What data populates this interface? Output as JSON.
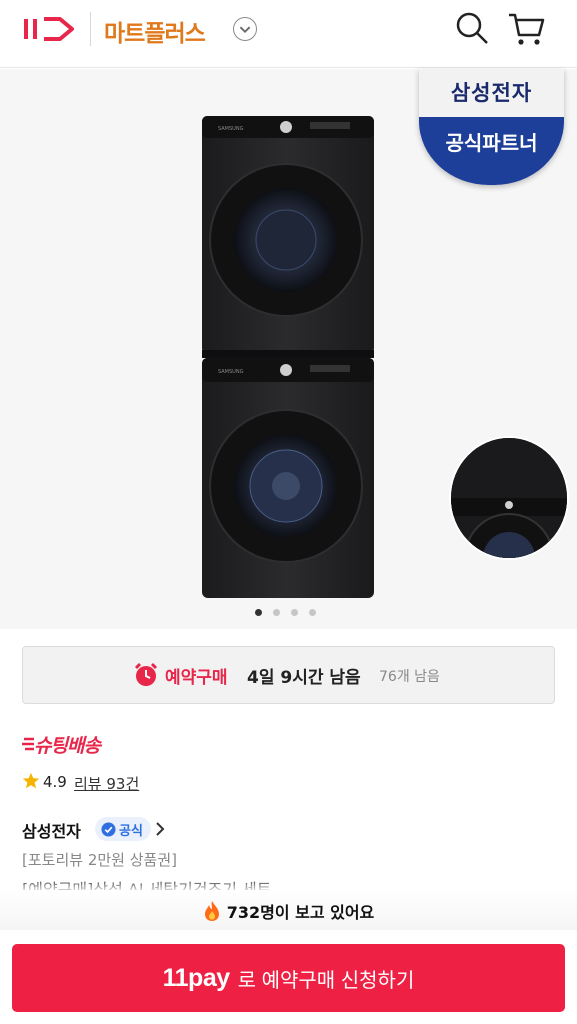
{
  "header": {
    "logo": "11",
    "brand": "마트플러스"
  },
  "gallery": {
    "badge_top": "삼성전자",
    "badge_bottom": "공식파트너",
    "pages": 4,
    "active_page": 1
  },
  "reservation": {
    "label": "예약구매",
    "time_left": "4일 9시간 남음",
    "remaining": "76개 남음"
  },
  "shipping": {
    "label": "슈팅배송"
  },
  "rating": {
    "score": "4.9",
    "reviews": "리뷰 93건"
  },
  "seller": {
    "name": "삼성전자",
    "official": "공식"
  },
  "promo": "[포토리뷰 2만원 상품권]",
  "product_title_partial": "[예약구매]삼성 AI 세탁기건조기 세트",
  "viewers": "732명이 보고 있어요",
  "cta": {
    "pay": "11pay",
    "label": "로 예약구매 신청하기"
  },
  "colors": {
    "brand_orange": "#e0791c",
    "accent_red": "#ee2145",
    "badge_blue": "#1d3f9a"
  }
}
